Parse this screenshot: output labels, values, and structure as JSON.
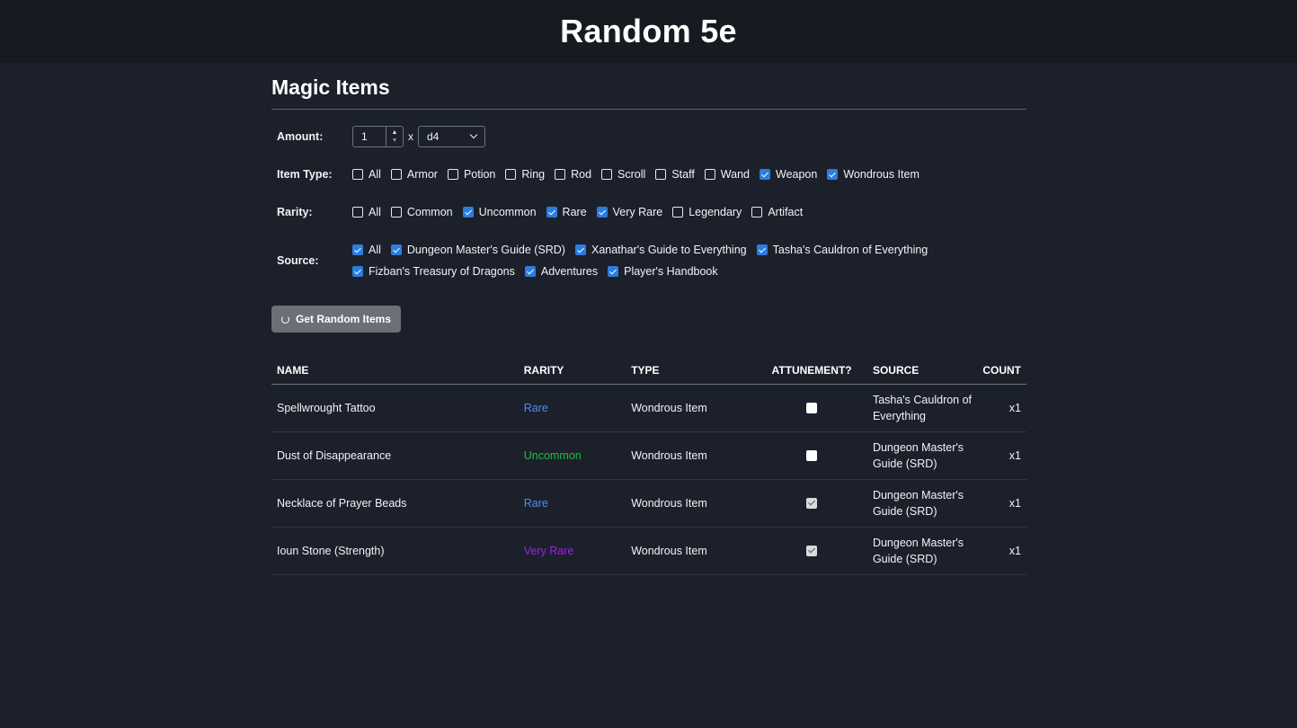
{
  "app": {
    "title": "Random 5e"
  },
  "section": {
    "title": "Magic Items"
  },
  "form": {
    "amount": {
      "label": "Amount:",
      "value": "1",
      "times": "x",
      "die": "d4"
    },
    "item_type": {
      "label": "Item Type:",
      "options": [
        {
          "label": "All",
          "checked": false
        },
        {
          "label": "Armor",
          "checked": false
        },
        {
          "label": "Potion",
          "checked": false
        },
        {
          "label": "Ring",
          "checked": false
        },
        {
          "label": "Rod",
          "checked": false
        },
        {
          "label": "Scroll",
          "checked": false
        },
        {
          "label": "Staff",
          "checked": false
        },
        {
          "label": "Wand",
          "checked": false
        },
        {
          "label": "Weapon",
          "checked": true
        },
        {
          "label": "Wondrous Item",
          "checked": true
        }
      ]
    },
    "rarity": {
      "label": "Rarity:",
      "options": [
        {
          "label": "All",
          "checked": false
        },
        {
          "label": "Common",
          "checked": false
        },
        {
          "label": "Uncommon",
          "checked": true
        },
        {
          "label": "Rare",
          "checked": true
        },
        {
          "label": "Very Rare",
          "checked": true
        },
        {
          "label": "Legendary",
          "checked": false
        },
        {
          "label": "Artifact",
          "checked": false
        }
      ]
    },
    "source": {
      "label": "Source:",
      "options": [
        {
          "label": "All",
          "checked": true
        },
        {
          "label": "Dungeon Master's Guide (SRD)",
          "checked": true
        },
        {
          "label": "Xanathar's Guide to Everything",
          "checked": true
        },
        {
          "label": "Tasha's Cauldron of Everything",
          "checked": true
        },
        {
          "label": "Fizban's Treasury of Dragons",
          "checked": true
        },
        {
          "label": "Adventures",
          "checked": true
        },
        {
          "label": "Player's Handbook",
          "checked": true
        }
      ]
    },
    "button": {
      "label": "Get Random Items",
      "icon": "refresh-icon"
    }
  },
  "table": {
    "headers": {
      "name": "NAME",
      "rarity": "RARITY",
      "type": "TYPE",
      "attunement": "ATTUNEMENT?",
      "source": "SOURCE",
      "count": "COUNT"
    },
    "rows": [
      {
        "name": "Spellwrought Tattoo",
        "rarity": "Rare",
        "rarity_color": "#4d8ff0",
        "type": "Wondrous Item",
        "attunement": false,
        "source": "Tasha's Cauldron of Everything",
        "count": "x1"
      },
      {
        "name": "Dust of Disappearance",
        "rarity": "Uncommon",
        "rarity_color": "#1fbf3b",
        "type": "Wondrous Item",
        "attunement": false,
        "source": "Dungeon Master's Guide (SRD)",
        "count": "x1"
      },
      {
        "name": "Necklace of Prayer Beads",
        "rarity": "Rare",
        "rarity_color": "#4d8ff0",
        "type": "Wondrous Item",
        "attunement": true,
        "source": "Dungeon Master's Guide (SRD)",
        "count": "x1"
      },
      {
        "name": "Ioun Stone (Strength)",
        "rarity": "Very Rare",
        "rarity_color": "#a020e8",
        "type": "Wondrous Item",
        "attunement": true,
        "source": "Dungeon Master's Guide (SRD)",
        "count": "x1"
      }
    ]
  },
  "colors": {
    "background": "#1b202b",
    "header_bar": "#171a20",
    "checkbox_accent": "#2b7ddf",
    "button": "#6b6f76"
  }
}
